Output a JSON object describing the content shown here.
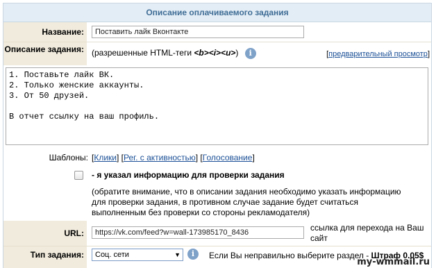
{
  "header": {
    "title": "Описание оплачиваемого задания"
  },
  "name_field": {
    "label": "Название:",
    "value": "Поставить лайк Вконтакте"
  },
  "description": {
    "label": "Описание задания:",
    "allowed_tags_prefix": "(разрешенные HTML-теги ",
    "allowed_tags": "<b><i><u>",
    "allowed_tags_suffix": ")",
    "info_icon": "i",
    "preview_left": "[",
    "preview_link": "предварительный просмотр",
    "preview_right": "]",
    "text": "1. Поставьте лайк ВК.\n2. Только женские аккаунты.\n3. От 50 друзей.\n\nВ отчет ссылку на ваш профиль."
  },
  "templates": {
    "label": "Шаблоны:",
    "items": [
      "Клики",
      "Рег. с активностью",
      "Голосование"
    ]
  },
  "confirm": {
    "checked": false,
    "label": "- я указал информацию для проверки задания",
    "note": "(обратите внимание, что в описании задания необходимо указать информацию для проверки задания, в противном случае задание будет считаться выполненным без проверки со стороны рекламодателя)"
  },
  "url_field": {
    "label": "URL:",
    "value": "https://vk.com/feed?w=wall-173985170_8436",
    "hint": "ссылка для перехода на Ваш сайт"
  },
  "task_type": {
    "label": "Тип задания:",
    "selected": "Соц. сети",
    "warning_prefix": "Если Вы неправильно выберите раздел - ",
    "warning_penalty": "Штраф 0.05$"
  },
  "watermark": "my-wmmail.ru",
  "colors": {
    "header_bg": "#e3edf6",
    "header_text": "#3f6d95",
    "label_bg": "#f1ebdd",
    "link": "#1a4f96"
  }
}
